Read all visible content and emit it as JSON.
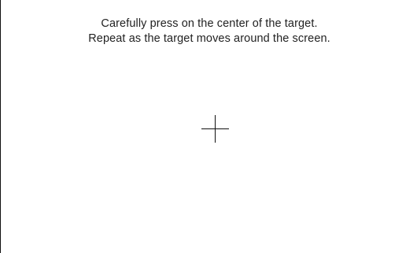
{
  "calibration": {
    "instruction_line_1": "Carefully press on the center of the target.",
    "instruction_line_2": "Repeat as the target moves around the screen.",
    "target_icon": "crosshair-icon"
  },
  "colors": {
    "background": "#ffffff",
    "text": "#222222",
    "target": "#111111"
  }
}
